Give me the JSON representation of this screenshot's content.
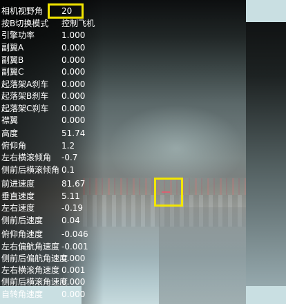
{
  "hud": {
    "rows": [
      {
        "label": "相机视野角",
        "value": "20"
      },
      {
        "label": "按B切换模式",
        "value": "控制飞机"
      },
      {
        "label": "引擎功率",
        "value": "1.000"
      },
      {
        "label": "副翼A",
        "value": "0.000"
      },
      {
        "label": "副翼B",
        "value": "0.000"
      },
      {
        "label": "副翼C",
        "value": "0.000"
      },
      {
        "label": "起落架A刹车",
        "value": "0.000"
      },
      {
        "label": "起落架B刹车",
        "value": "0.000"
      },
      {
        "label": "起落架C刹车",
        "value": "0.000"
      },
      {
        "label": "襟翼",
        "value": "0.000"
      },
      {
        "label": "高度",
        "value": "51.74"
      },
      {
        "label": "俯仰角",
        "value": "1.2"
      },
      {
        "label": "左右横滚倾角",
        "value": "-0.7"
      },
      {
        "label": "侧前后横滚倾角",
        "value": "0.1"
      },
      {
        "label": "前进速度",
        "value": "81.67"
      },
      {
        "label": "垂直速度",
        "value": "5.11"
      },
      {
        "label": "左右速度",
        "value": "-0.19"
      },
      {
        "label": "侧前后速度",
        "value": "0.04"
      },
      {
        "label": "俯仰角速度",
        "value": "-0.046"
      },
      {
        "label": "左右偏航角速度",
        "value": "-0.001"
      },
      {
        "label": "侧前后偏航角速度",
        "value": "0.000"
      },
      {
        "label": "左右横滚角速度",
        "value": "0.001"
      },
      {
        "label": "侧前后横滚角速度",
        "value": "0.000"
      },
      {
        "label": "自转角速度",
        "value": "0.000"
      }
    ]
  },
  "colors": {
    "highlight": "#f3e600",
    "text": "#ffffff"
  }
}
